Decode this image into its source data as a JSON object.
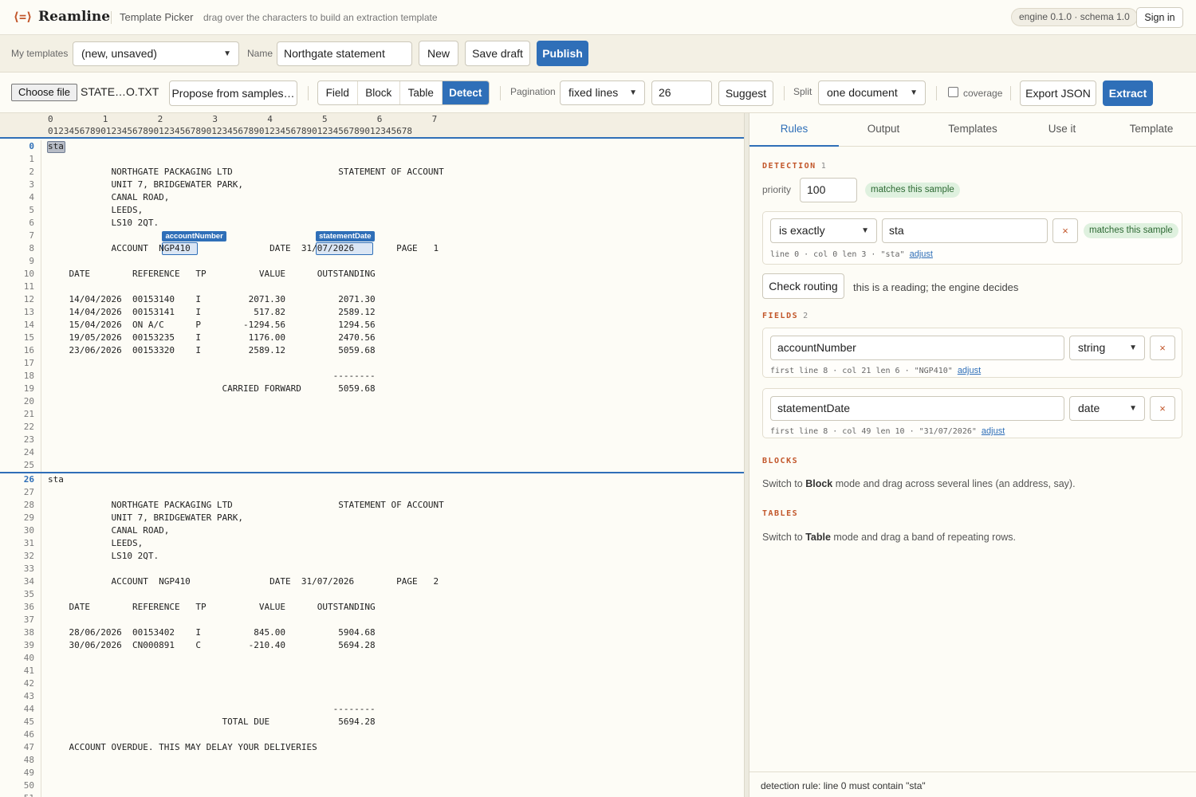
{
  "header": {
    "logo_glyph": "⟨=⟩",
    "brand": "Reamline",
    "title": "Template Picker",
    "hint": "drag over the characters to build an extraction template",
    "engine_badge": "engine 0.1.0 · schema 1.0",
    "signin": "Sign in"
  },
  "templates_bar": {
    "my_templates_label": "My templates",
    "template_select": "(new, unsaved)",
    "name_label": "Name",
    "name_value": "Northgate statement",
    "new_btn": "New",
    "save_draft_btn": "Save draft",
    "publish_btn": "Publish"
  },
  "toolbar": {
    "choose_file": "Choose file",
    "file_name": "STATE…O.TXT",
    "propose_btn": "Propose from samples…",
    "modes": [
      "Field",
      "Block",
      "Table",
      "Detect"
    ],
    "active_mode": "Detect",
    "pagination_label": "Pagination",
    "pagination_value": "fixed lines",
    "lines_value": "26",
    "suggest_btn": "Suggest",
    "split_label": "Split",
    "split_value": "one document",
    "coverage_label": "coverage",
    "coverage_checked": false,
    "export_btn": "Export JSON",
    "extract_btn": "Extract"
  },
  "ruler": {
    "tens": [
      "0",
      "1",
      "2",
      "3",
      "4",
      "5",
      "6",
      "7"
    ],
    "cols": "012345678901234567890123456789012345678901234567890123456789012345678"
  },
  "document_lines": [
    "sta",
    "",
    "            NORTHGATE PACKAGING LTD                    STATEMENT OF ACCOUNT",
    "            UNIT 7, BRIDGEWATER PARK,",
    "            CANAL ROAD,",
    "            LEEDS,",
    "            LS10 2QT.",
    "",
    "            ACCOUNT  NGP410               DATE  31/07/2026        PAGE   1",
    "",
    "    DATE        REFERENCE   TP          VALUE      OUTSTANDING",
    "",
    "    14/04/2026  00153140    I         2071.30          2071.30",
    "    14/04/2026  00153141    I          517.82          2589.12",
    "    15/04/2026  ON A/C      P        -1294.56          1294.56",
    "    19/05/2026  00153235    I         1176.00          2470.56",
    "    23/06/2026  00153320    I         2589.12          5059.68",
    "",
    "                                                      --------",
    "                                 CARRIED FORWARD       5059.68",
    "",
    "",
    "",
    "",
    "",
    "",
    "sta",
    "",
    "            NORTHGATE PACKAGING LTD                    STATEMENT OF ACCOUNT",
    "            UNIT 7, BRIDGEWATER PARK,",
    "            CANAL ROAD,",
    "            LEEDS,",
    "            LS10 2QT.",
    "",
    "            ACCOUNT  NGP410               DATE  31/07/2026        PAGE   2",
    "",
    "    DATE        REFERENCE   TP          VALUE      OUTSTANDING",
    "",
    "    28/06/2026  00153402    I          845.00          5904.68",
    "    30/06/2026  CN000891    C         -210.40          5694.28",
    "",
    "",
    "",
    "",
    "                                                      --------",
    "                                 TOTAL DUE             5694.28",
    "",
    "    ACCOUNT OVERDUE. THIS MAY DELAY YOUR DELIVERIES",
    "",
    "",
    "",
    ""
  ],
  "page_start_lines": [
    0,
    26
  ],
  "detection_highlight": {
    "line": 0,
    "col": 0,
    "len": 3
  },
  "field_highlights": [
    {
      "name": "accountNumber",
      "line": 8,
      "col": 21,
      "len": 6
    },
    {
      "name": "statementDate",
      "line": 8,
      "col": 49,
      "len": 10
    }
  ],
  "panel": {
    "tabs": [
      "Rules",
      "Output",
      "Templates",
      "Use it",
      "Template"
    ],
    "active_tab": "Rules",
    "detection": {
      "title": "DETECTION",
      "count": "1",
      "priority_label": "priority",
      "priority_value": "100",
      "match_pill": "matches this sample",
      "rule_op": "is exactly",
      "rule_value": "sta",
      "rule_remove": "×",
      "rule_pill": "matches this sample",
      "rule_meta": "line 0 · col 0 len 3 · \"sta\"",
      "adjust": "adjust",
      "check_routing": "Check routing",
      "routing_note": "this is a reading; the engine decides"
    },
    "fields": {
      "title": "FIELDS",
      "count": "2",
      "items": [
        {
          "name": "accountNumber",
          "type": "string",
          "remove": "×",
          "meta": "first line 8 · col 21 len 6 · \"NGP410\"",
          "adjust": "adjust"
        },
        {
          "name": "statementDate",
          "type": "date",
          "remove": "×",
          "meta": "first line 8 · col 49 len 10 · \"31/07/2026\"",
          "adjust": "adjust"
        }
      ]
    },
    "blocks": {
      "title": "BLOCKS",
      "help_pre": "Switch to ",
      "help_bold": "Block",
      "help_post": " mode and drag across several lines (an address, say)."
    },
    "tables": {
      "title": "TABLES",
      "help_pre": "Switch to ",
      "help_bold": "Table",
      "help_post": " mode and drag a band of repeating rows."
    },
    "status": "detection rule: line 0 must contain \"sta\""
  },
  "colors": {
    "accent": "#2f6fb8",
    "brand_orange": "#c2562a",
    "match_green": "#dff1df"
  }
}
